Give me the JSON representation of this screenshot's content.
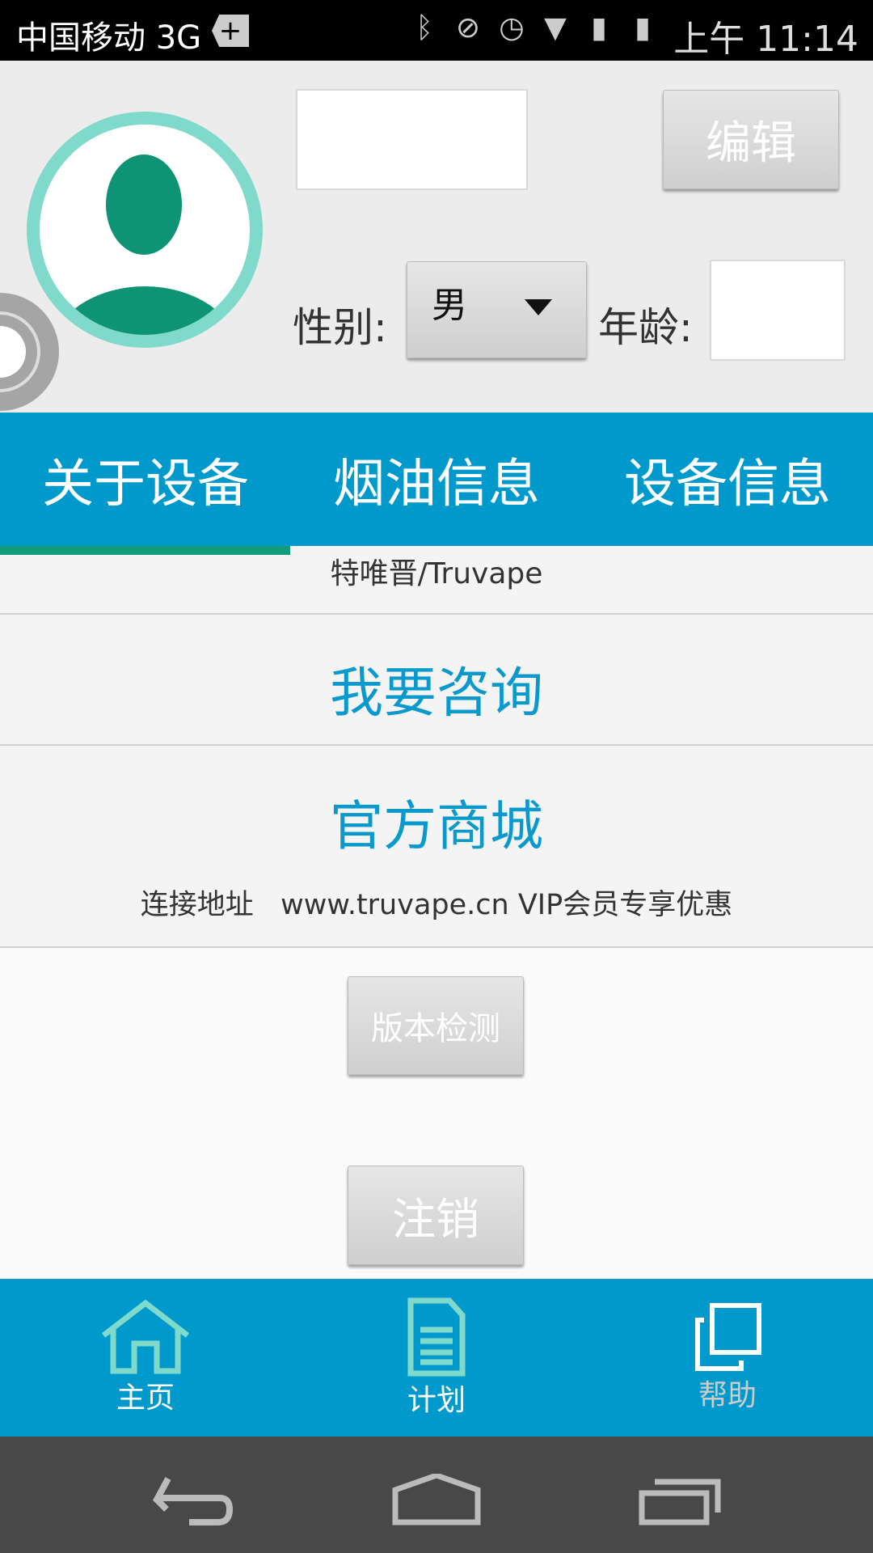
{
  "status_bar": {
    "carrier": "中国移动 3G",
    "time": "上午 11:14",
    "icons": [
      "plus-badge-icon",
      "bluetooth-icon",
      "mute-icon",
      "alarm-icon",
      "wifi-icon",
      "signal-icon",
      "battery-icon"
    ]
  },
  "profile": {
    "name_value": "",
    "edit_label": "编辑",
    "gender_label": "性别:",
    "gender_value": "男",
    "age_label": "年龄:",
    "age_value": ""
  },
  "tabs": [
    {
      "label": "关于设备",
      "active": true
    },
    {
      "label": "烟油信息"
    },
    {
      "label": "设备信息"
    }
  ],
  "content": {
    "brand": "特唯晋/Truvape",
    "consult": "我要咨询",
    "shop": "官方商城",
    "shop_link": "连接地址   www.truvape.cn VIP会员专享优惠",
    "version_check": "版本检测",
    "logout": "注销"
  },
  "bottom_nav": [
    {
      "label": "主页",
      "icon": "home-icon"
    },
    {
      "label": "计划",
      "icon": "document-icon"
    },
    {
      "label": "帮助",
      "icon": "copy-icon"
    }
  ],
  "colors": {
    "accent": "#0099cc",
    "indicator": "#129c7c",
    "avatar": "#0e9474",
    "avatar_ring": "#7fdacb"
  }
}
